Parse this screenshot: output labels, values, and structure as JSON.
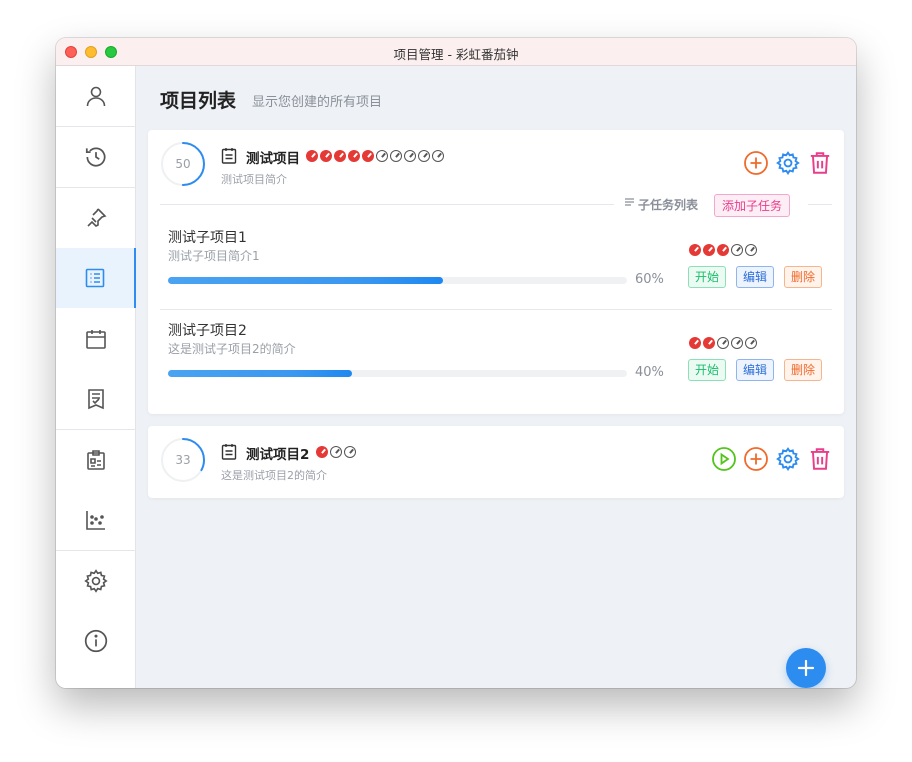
{
  "window": {
    "title": "项目管理 - 彩虹番茄钟"
  },
  "sidebar": {
    "items": [
      {
        "name": "user-icon"
      },
      {
        "name": "history-clock-icon"
      },
      {
        "name": "pin-icon"
      },
      {
        "name": "project-list-icon",
        "active": true
      },
      {
        "name": "calendar-icon"
      },
      {
        "name": "task-checklist-icon"
      },
      {
        "name": "clipboard-icon"
      },
      {
        "name": "scatter-chart-icon"
      },
      {
        "name": "gear-icon"
      },
      {
        "name": "info-icon"
      }
    ]
  },
  "header": {
    "title": "项目列表",
    "subtitle": "显示您创建的所有项目"
  },
  "projects": [
    {
      "progress": 50,
      "progress_label": "50",
      "title": "测试项目",
      "description": "测试项目简介",
      "tomatoes_done": 5,
      "tomatoes_total": 10,
      "subtask_section_label": "子任务列表",
      "add_subtask_label": "添加子任务",
      "subtasks": [
        {
          "title": "测试子项目1",
          "description": "测试子项目简介1",
          "progress": 60,
          "progress_label": "60%",
          "tomatoes_done": 3,
          "tomatoes_total": 5,
          "start_label": "开始",
          "edit_label": "编辑",
          "delete_label": "删除"
        },
        {
          "title": "测试子项目2",
          "description": "这是测试子项目2的简介",
          "progress": 40,
          "progress_label": "40%",
          "tomatoes_done": 2,
          "tomatoes_total": 5,
          "start_label": "开始",
          "edit_label": "编辑",
          "delete_label": "删除"
        }
      ]
    },
    {
      "progress": 33,
      "progress_label": "33",
      "title": "测试项目2",
      "description": "这是测试项目2的简介",
      "tomatoes_done": 1,
      "tomatoes_total": 3
    }
  ],
  "colors": {
    "accent": "#2d8cf0",
    "tomato": "#e53935",
    "add": "#f06a2b",
    "delete": "#e83e8c",
    "play": "#52c41a"
  }
}
